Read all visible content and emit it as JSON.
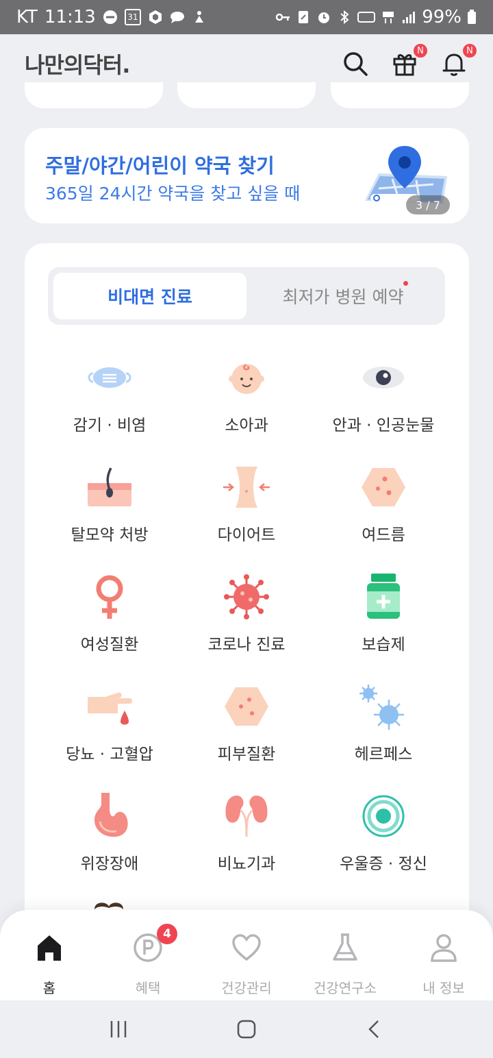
{
  "status_bar": {
    "carrier": "KT",
    "time": "11:13",
    "calendar_day": "31",
    "battery": "99%"
  },
  "header": {
    "logo": "나만의닥터.",
    "gift_badge": "N",
    "bell_badge": "N"
  },
  "banner": {
    "title": "주말/야간/어린이 약국 찾기",
    "subtitle": "365일 24시간 약국을 찾고 싶을 때",
    "pager": "3 / 7"
  },
  "segment": {
    "active": "비대면 진료",
    "inactive": "최저가 병원 예약"
  },
  "categories": [
    {
      "label": "감기 · 비염",
      "icon": "mask-icon"
    },
    {
      "label": "소아과",
      "icon": "baby-icon"
    },
    {
      "label": "안과 · 인공눈물",
      "icon": "eye-icon"
    },
    {
      "label": "탈모약 처방",
      "icon": "hair-follicle-icon"
    },
    {
      "label": "다이어트",
      "icon": "waist-icon"
    },
    {
      "label": "여드름",
      "icon": "acne-icon"
    },
    {
      "label": "여성질환",
      "icon": "female-symbol-icon"
    },
    {
      "label": "코로나 진료",
      "icon": "virus-icon"
    },
    {
      "label": "보습제",
      "icon": "medicine-bottle-icon"
    },
    {
      "label": "당뇨 · 고혈압",
      "icon": "blood-drop-finger-icon"
    },
    {
      "label": "피부질환",
      "icon": "skin-icon"
    },
    {
      "label": "헤르페스",
      "icon": "herpes-virus-icon"
    },
    {
      "label": "위장장애",
      "icon": "stomach-icon"
    },
    {
      "label": "비뇨기과",
      "icon": "kidney-icon"
    },
    {
      "label": "우울증 · 정신",
      "icon": "mind-target-icon"
    }
  ],
  "bottom_nav": {
    "home": "홈",
    "benefits": "혜택",
    "benefits_badge": "4",
    "health": "건강관리",
    "lab": "건강연구소",
    "profile": "내 정보"
  },
  "colors": {
    "brand_blue": "#2f6ee0",
    "badge_red": "#f04452",
    "background": "#eeeff3"
  }
}
